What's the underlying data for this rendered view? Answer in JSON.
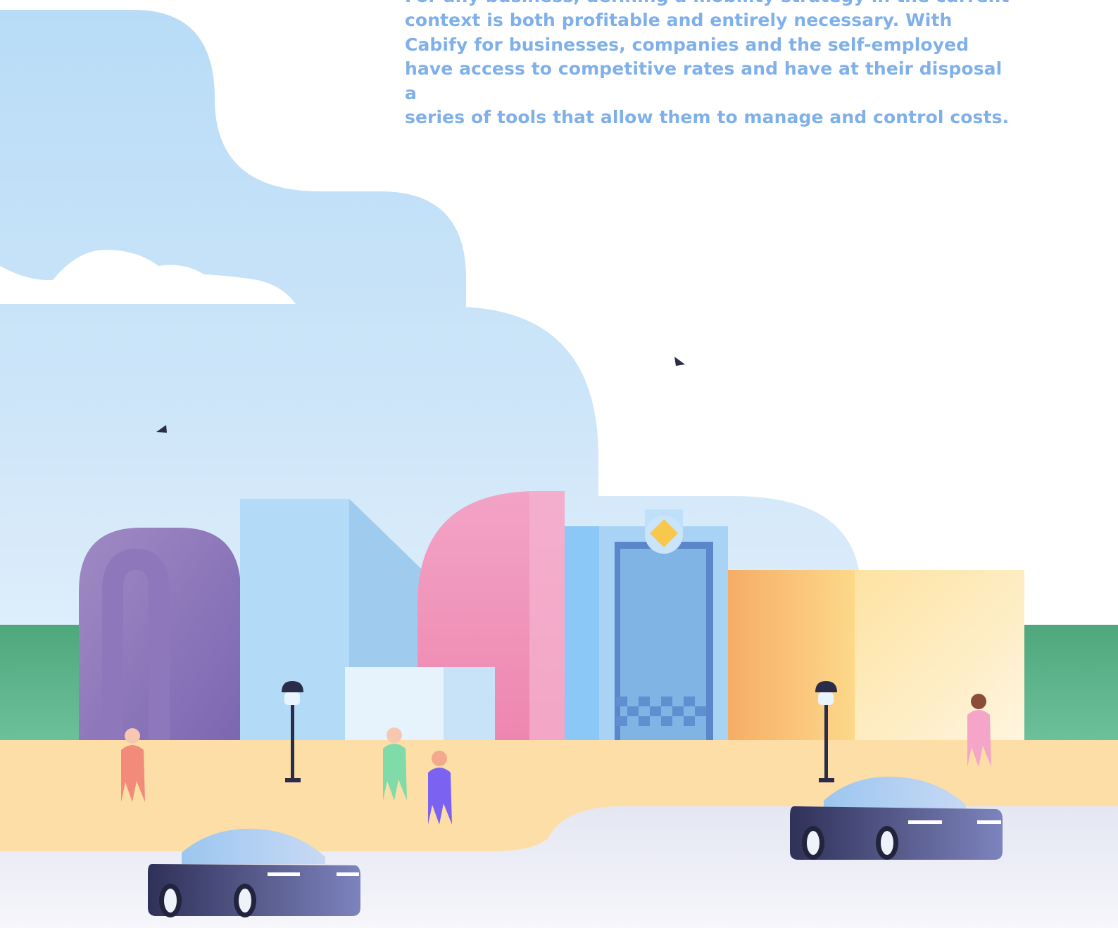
{
  "intro": {
    "lines": [
      "For any business, defining a mobility strategy in the current",
      "context is both profitable and entirely necessary. With",
      "Cabify for businesses, companies and the self-employed",
      "have access to competitive rates and have at their disposal a",
      "series of tools that allow them to manage and control costs."
    ]
  },
  "illustration": {
    "subject": "city-street-illustration",
    "colors": {
      "sky": "#c9e3fa",
      "park": "#5aad86",
      "sidewalk": "#fce0ab",
      "road": "#e9eaf3",
      "text_accent": "#7fb0ea",
      "car_body": "#3c3f6b"
    }
  }
}
